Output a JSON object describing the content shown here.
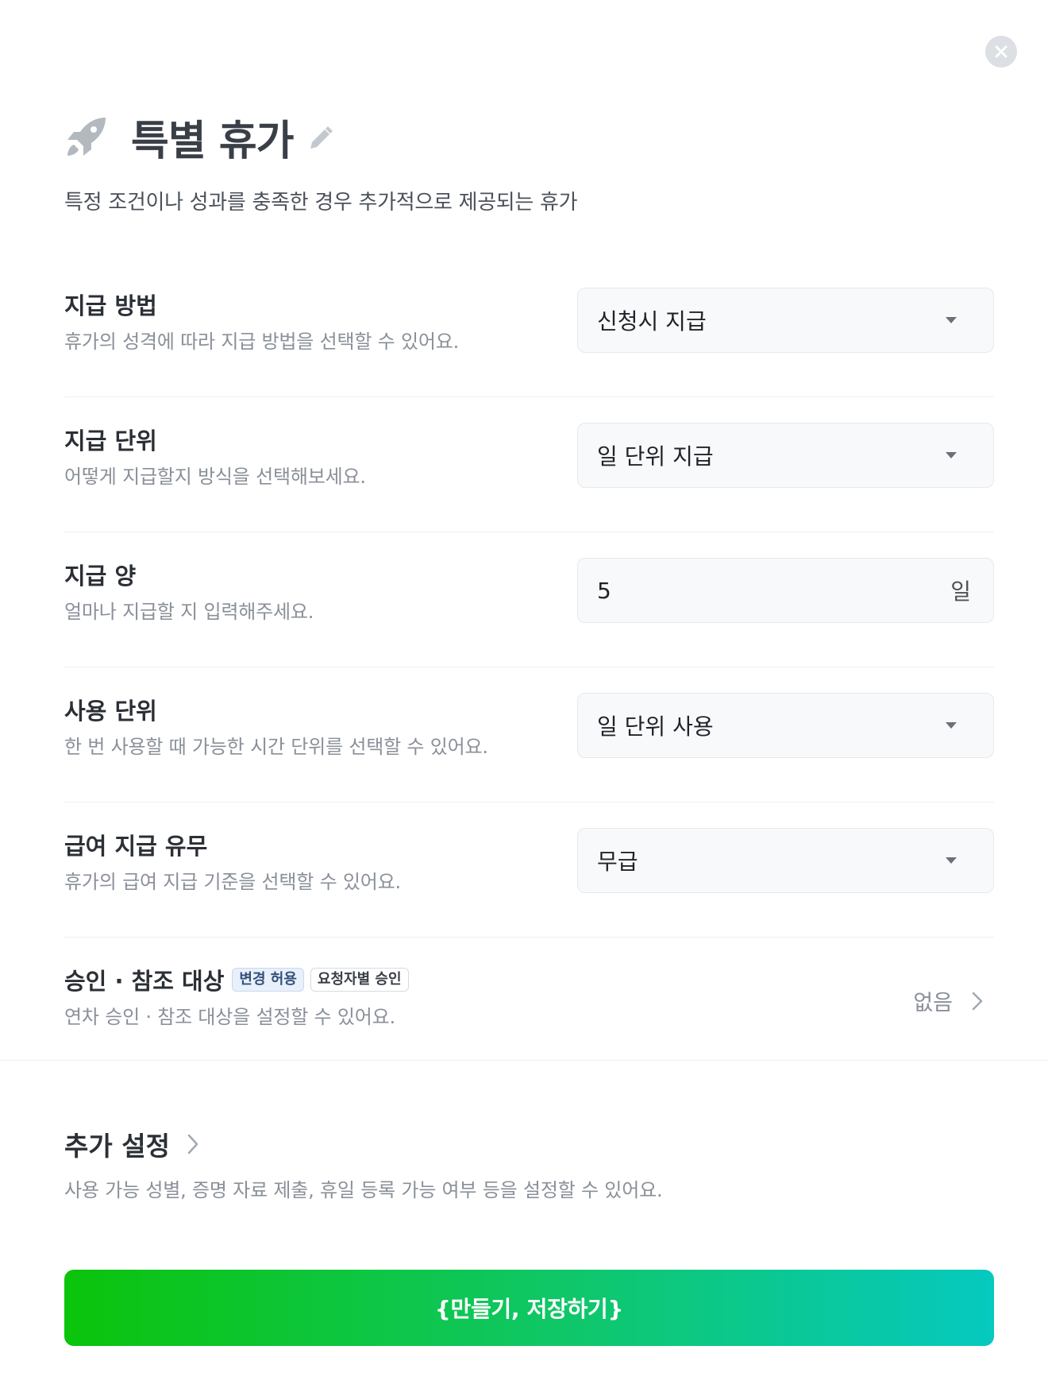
{
  "header": {
    "title": "특별 휴가",
    "description": "특정 조건이나 성과를 충족한 경우 추가적으로 제공되는 휴가"
  },
  "settings": [
    {
      "label": "지급 방법",
      "sub": "휴가의 성격에 따라 지급 방법을 선택할 수 있어요.",
      "value": "신청시 지급"
    },
    {
      "label": "지급 단위",
      "sub": "어떻게 지급할지 방식을 선택해보세요.",
      "value": "일 단위 지급"
    },
    {
      "label": "지급 양",
      "sub": "얼마나 지급할 지 입력해주세요.",
      "value": "5",
      "unit": "일"
    },
    {
      "label": "사용 단위",
      "sub": "한 번 사용할 때 가능한 시간 단위를 선택할 수 있어요.",
      "value": "일 단위 사용"
    },
    {
      "label": "급여 지급 유무",
      "sub": "휴가의 급여 지급 기준을 선택할 수 있어요.",
      "value": "무급"
    }
  ],
  "approval": {
    "label": "승인 · 참조 대상",
    "badge_change": "변경 허용",
    "badge_request": "요청자별 승인",
    "sub": "연차 승인 · 참조 대상을 설정할 수 있어요.",
    "value": "없음"
  },
  "extra": {
    "title": "추가 설정",
    "sub": "사용 가능 성별, 증명 자료 제출, 휴일 등록 가능 여부 등을 설정할 수 있어요."
  },
  "submit_label": "{만들기, 저장하기}",
  "colors": {
    "accent_start": "#0bc40b",
    "accent_end": "#06c9c0",
    "icon_gray": "#b4b9c0"
  },
  "icons": {
    "close": "close-icon",
    "rocket": "rocket-icon",
    "edit": "pencil-icon",
    "dropdown": "caret-down-icon",
    "chevron": "chevron-right-icon"
  }
}
